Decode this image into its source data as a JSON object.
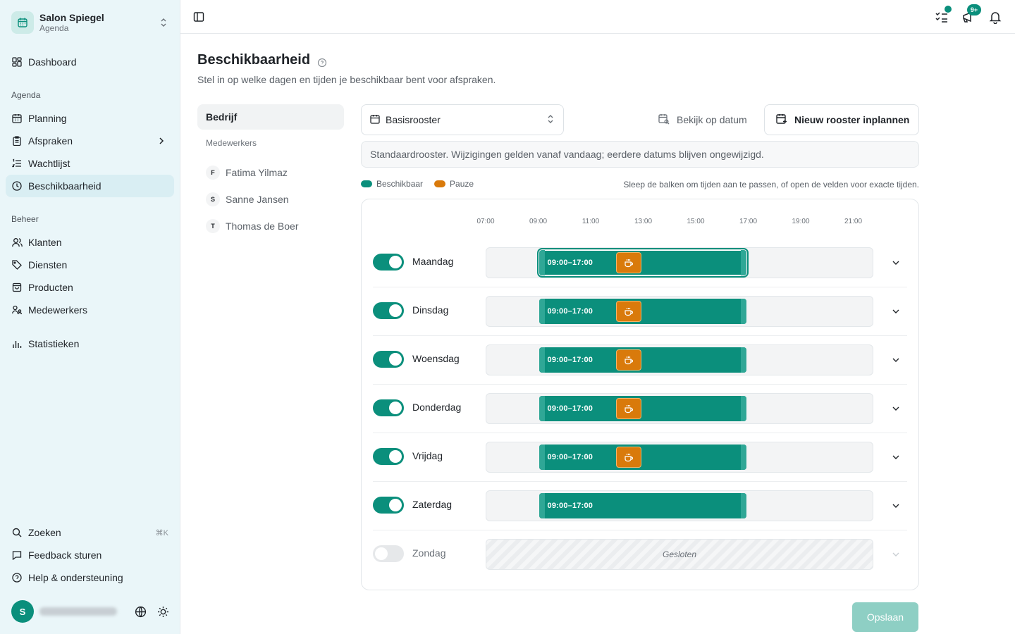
{
  "brand": {
    "name": "Salon Spiegel",
    "sub": "Agenda"
  },
  "nav": {
    "dashboard": "Dashboard",
    "section_agenda": "Agenda",
    "planning": "Planning",
    "afspraken": "Afspraken",
    "wachtlijst": "Wachtlijst",
    "beschikbaarheid": "Beschikbaarheid",
    "section_beheer": "Beheer",
    "klanten": "Klanten",
    "diensten": "Diensten",
    "producten": "Producten",
    "medewerkers": "Medewerkers",
    "statistieken": "Statistieken",
    "zoeken": "Zoeken",
    "zoeken_shortcut": "⌘K",
    "feedback": "Feedback sturen",
    "help": "Help & ondersteuning"
  },
  "user": {
    "initial": "S"
  },
  "topbar": {
    "notification_badge": "9+"
  },
  "page": {
    "title": "Beschikbaarheid",
    "subtitle": "Stel in op welke dagen en tijden je beschikbaar bent voor afspraken."
  },
  "staff": {
    "company": "Bedrijf",
    "label": "Medewerkers",
    "members": [
      {
        "initial": "F",
        "name": "Fatima Yilmaz"
      },
      {
        "initial": "S",
        "name": "Sanne Jansen"
      },
      {
        "initial": "T",
        "name": "Thomas de Boer"
      }
    ]
  },
  "schedule": {
    "selected": "Basisrooster",
    "view_on_date": "Bekijk op datum",
    "new_schedule": "Nieuw rooster inplannen",
    "info": "Standaardrooster. Wijzigingen gelden vanaf vandaag; eerdere datums blijven ongewijzigd.",
    "legend_available": "Beschikbaar",
    "legend_pause": "Pauze",
    "hint": "Sleep de balken om tijden aan te passen, of open de velden voor exacte tijden.",
    "ticks": [
      "07:00",
      "09:00",
      "11:00",
      "13:00",
      "15:00",
      "17:00",
      "19:00",
      "21:00"
    ],
    "closed_label": "Gesloten",
    "days": [
      {
        "name": "Maandag",
        "enabled": true,
        "range": "09:00–17:00",
        "start": 9,
        "end": 17,
        "pause": 12
      },
      {
        "name": "Dinsdag",
        "enabled": true,
        "range": "09:00–17:00",
        "start": 9,
        "end": 17,
        "pause": 12
      },
      {
        "name": "Woensdag",
        "enabled": true,
        "range": "09:00–17:00",
        "start": 9,
        "end": 17,
        "pause": 12
      },
      {
        "name": "Donderdag",
        "enabled": true,
        "range": "09:00–17:00",
        "start": 9,
        "end": 17,
        "pause": 12
      },
      {
        "name": "Vrijdag",
        "enabled": true,
        "range": "09:00–17:00",
        "start": 9,
        "end": 17,
        "pause": 12
      },
      {
        "name": "Zaterdag",
        "enabled": true,
        "range": "09:00–17:00",
        "start": 9,
        "end": 17,
        "pause": null
      },
      {
        "name": "Zondag",
        "enabled": false,
        "range": "",
        "start": null,
        "end": null,
        "pause": null
      }
    ],
    "save": "Opslaan"
  },
  "colors": {
    "accent": "#0b8f7c",
    "pause": "#d97a0b",
    "sidebar_bg": "#eaf6f9"
  }
}
